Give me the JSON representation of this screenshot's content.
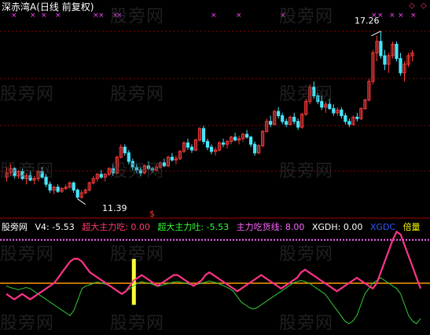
{
  "title": "深赤湾A(日线 前复权)",
  "price_high_label": "17.26",
  "price_low_label": "11.39",
  "watermark": "股旁网",
  "indicator_bar": {
    "source": "股旁网",
    "v4": {
      "label": "V4:",
      "value": "-5.53"
    },
    "items": [
      {
        "label": "超大主力吃:",
        "value": "0.00",
        "color": "#ff3b6b"
      },
      {
        "label": "超大主力吐:",
        "value": "-5.53",
        "color": "#33ff33"
      },
      {
        "label": "主力吃货线:",
        "value": "8.00",
        "color": "#ff66ff"
      },
      {
        "label": "XGDH:",
        "value": "0.00",
        "color": "#ffffff"
      },
      {
        "label": "XGDC",
        "value": "",
        "color": "#3355ff"
      },
      {
        "label": "倍量",
        "value": "",
        "color": "#ffff00"
      }
    ]
  },
  "colors": {
    "up": "#ff3b3b",
    "down": "#46e6ff",
    "grid": "#8a0000",
    "pink_line": "#ff3388",
    "green_line": "#33cc33",
    "orange_line": "#ff9900",
    "dotted_line": "#ff66ff",
    "yellow_bar": "#ffff33"
  },
  "icons": [
    "diamond-icon",
    "up-arrow-icon",
    "dollar-icon",
    "x-marker-icon"
  ],
  "price_axis_range": [
    10.8,
    17.8
  ],
  "candles": [
    [
      12.15,
      12.5,
      12.0,
      12.3
    ],
    [
      12.3,
      12.6,
      12.2,
      12.45
    ],
    [
      12.45,
      12.5,
      12.1,
      12.2
    ],
    [
      12.2,
      12.4,
      12.1,
      12.35
    ],
    [
      12.35,
      12.45,
      12.05,
      12.1
    ],
    [
      12.1,
      12.3,
      11.9,
      12.2
    ],
    [
      12.2,
      12.35,
      12.0,
      12.05
    ],
    [
      12.05,
      12.2,
      11.9,
      12.1
    ],
    [
      12.1,
      12.4,
      12.0,
      12.35
    ],
    [
      12.35,
      12.5,
      12.1,
      12.15
    ],
    [
      12.15,
      12.25,
      11.8,
      11.9
    ],
    [
      11.9,
      12.0,
      11.6,
      11.7
    ],
    [
      11.7,
      11.85,
      11.55,
      11.8
    ],
    [
      11.8,
      11.9,
      11.6,
      11.65
    ],
    [
      11.65,
      11.8,
      11.6,
      11.75
    ],
    [
      11.75,
      11.9,
      11.7,
      11.8
    ],
    [
      11.8,
      12.0,
      11.75,
      11.95
    ],
    [
      11.95,
      12.0,
      11.6,
      11.7
    ],
    [
      11.7,
      11.75,
      11.39,
      11.45
    ],
    [
      11.45,
      11.7,
      11.4,
      11.6
    ],
    [
      11.6,
      11.75,
      11.55,
      11.7
    ],
    [
      11.7,
      12.0,
      11.65,
      11.95
    ],
    [
      11.95,
      12.2,
      11.9,
      12.1
    ],
    [
      12.1,
      12.3,
      12.0,
      12.25
    ],
    [
      12.25,
      12.4,
      12.1,
      12.15
    ],
    [
      12.15,
      12.3,
      12.0,
      12.25
    ],
    [
      12.25,
      12.5,
      12.2,
      12.45
    ],
    [
      12.45,
      12.6,
      12.2,
      12.3
    ],
    [
      12.3,
      12.9,
      12.25,
      12.85
    ],
    [
      12.85,
      13.3,
      12.8,
      13.2
    ],
    [
      13.2,
      13.3,
      12.9,
      13.0
    ],
    [
      13.0,
      13.1,
      12.6,
      12.7
    ],
    [
      12.7,
      12.8,
      12.4,
      12.5
    ],
    [
      12.5,
      12.6,
      12.3,
      12.4
    ],
    [
      12.4,
      12.5,
      12.2,
      12.3
    ],
    [
      12.3,
      12.6,
      12.25,
      12.55
    ],
    [
      12.55,
      12.7,
      12.4,
      12.45
    ],
    [
      12.45,
      12.5,
      12.3,
      12.4
    ],
    [
      12.4,
      12.6,
      12.35,
      12.5
    ],
    [
      12.5,
      12.7,
      12.45,
      12.65
    ],
    [
      12.65,
      12.8,
      12.5,
      12.55
    ],
    [
      12.55,
      12.9,
      12.5,
      12.85
    ],
    [
      12.85,
      13.0,
      12.7,
      12.75
    ],
    [
      12.75,
      12.9,
      12.6,
      12.8
    ],
    [
      12.8,
      13.1,
      12.75,
      13.05
    ],
    [
      13.05,
      13.4,
      13.0,
      13.35
    ],
    [
      13.35,
      13.5,
      13.1,
      13.2
    ],
    [
      13.2,
      13.3,
      13.0,
      13.1
    ],
    [
      13.1,
      13.5,
      13.05,
      13.45
    ],
    [
      13.45,
      13.9,
      13.4,
      13.85
    ],
    [
      13.85,
      13.95,
      13.3,
      13.4
    ],
    [
      13.4,
      13.5,
      13.1,
      13.2
    ],
    [
      13.2,
      13.3,
      12.95,
      13.05
    ],
    [
      13.05,
      13.2,
      12.9,
      13.1
    ],
    [
      13.1,
      13.4,
      13.05,
      13.35
    ],
    [
      13.35,
      13.5,
      13.2,
      13.3
    ],
    [
      13.3,
      13.45,
      13.15,
      13.4
    ],
    [
      13.4,
      13.6,
      13.3,
      13.55
    ],
    [
      13.55,
      13.7,
      13.4,
      13.45
    ],
    [
      13.45,
      13.6,
      13.3,
      13.5
    ],
    [
      13.5,
      13.7,
      13.4,
      13.65
    ],
    [
      13.65,
      13.8,
      13.5,
      13.55
    ],
    [
      13.55,
      13.6,
      13.2,
      13.3
    ],
    [
      13.3,
      13.4,
      12.9,
      13.0
    ],
    [
      13.0,
      13.3,
      12.95,
      13.25
    ],
    [
      13.25,
      13.8,
      13.2,
      13.75
    ],
    [
      13.75,
      14.2,
      13.7,
      14.1
    ],
    [
      14.1,
      14.3,
      13.9,
      14.0
    ],
    [
      14.0,
      14.5,
      13.95,
      14.45
    ],
    [
      14.45,
      14.6,
      14.2,
      14.3
    ],
    [
      14.3,
      14.4,
      14.0,
      14.1
    ],
    [
      14.1,
      14.2,
      13.9,
      14.0
    ],
    [
      14.0,
      14.3,
      13.95,
      14.25
    ],
    [
      14.25,
      14.4,
      14.0,
      14.1
    ],
    [
      14.1,
      14.2,
      13.8,
      13.9
    ],
    [
      13.9,
      14.4,
      13.85,
      14.35
    ],
    [
      14.35,
      14.9,
      14.3,
      14.8
    ],
    [
      14.8,
      15.4,
      14.7,
      15.3
    ],
    [
      15.3,
      15.5,
      14.9,
      15.0
    ],
    [
      15.0,
      15.1,
      14.7,
      14.8
    ],
    [
      14.8,
      15.0,
      14.5,
      14.6
    ],
    [
      14.6,
      14.8,
      14.4,
      14.7
    ],
    [
      14.7,
      14.9,
      14.5,
      14.55
    ],
    [
      14.55,
      14.7,
      14.3,
      14.4
    ],
    [
      14.4,
      14.6,
      14.3,
      14.5
    ],
    [
      14.5,
      14.6,
      14.2,
      14.3
    ],
    [
      14.3,
      14.4,
      14.0,
      14.1
    ],
    [
      14.1,
      14.2,
      13.9,
      14.0
    ],
    [
      14.0,
      14.3,
      13.95,
      14.25
    ],
    [
      14.25,
      14.4,
      14.1,
      14.2
    ],
    [
      14.2,
      14.6,
      14.15,
      14.55
    ],
    [
      14.55,
      14.9,
      14.5,
      14.85
    ],
    [
      14.85,
      15.6,
      14.8,
      15.5
    ],
    [
      15.5,
      16.6,
      15.4,
      16.5
    ],
    [
      16.5,
      17.1,
      16.2,
      16.9
    ],
    [
      16.9,
      17.26,
      16.3,
      16.4
    ],
    [
      16.4,
      16.6,
      15.9,
      16.1
    ],
    [
      16.1,
      16.5,
      15.8,
      16.4
    ],
    [
      16.4,
      16.9,
      16.3,
      16.8
    ],
    [
      16.8,
      16.9,
      16.2,
      16.3
    ],
    [
      16.3,
      16.5,
      15.7,
      15.8
    ],
    [
      15.8,
      16.2,
      15.5,
      16.1
    ],
    [
      16.1,
      16.5,
      16.0,
      16.4
    ],
    [
      16.4,
      16.6,
      16.2,
      16.5
    ]
  ],
  "indicator_range": [
    -9,
    10
  ],
  "pink_series": [
    -2,
    -2.5,
    -3,
    -2.5,
    -2,
    -2.5,
    -3,
    -2.5,
    -2,
    -1.5,
    -1,
    -0.5,
    0,
    1,
    2,
    3,
    4,
    4.5,
    4.5,
    4,
    3,
    2,
    1.5,
    1,
    0.5,
    0,
    -0.5,
    -1,
    -1.5,
    -2,
    -1.5,
    -0.5,
    0.5,
    1,
    1.5,
    1,
    0.5,
    0,
    -0.5,
    0,
    0.5,
    1,
    1.5,
    1.5,
    1,
    0.5,
    0,
    -0.5,
    0,
    0.5,
    1.5,
    2,
    1.5,
    1,
    0.5,
    0,
    -0.5,
    -1,
    -1.5,
    -1,
    -0.5,
    0,
    0.5,
    1,
    1.5,
    1,
    0.5,
    0,
    -0.5,
    -1,
    -0.5,
    0,
    0.5,
    1,
    2,
    2.5,
    2,
    1.5,
    1,
    0.5,
    0,
    -0.5,
    -1,
    -1.5,
    -1,
    -0.5,
    0,
    0.5,
    1,
    0.5,
    0,
    -0.5,
    -1,
    0,
    2,
    4,
    6,
    8,
    9.5,
    9,
    7,
    5,
    3,
    1,
    -1
  ],
  "green_series": [
    -0.5,
    -0.8,
    -1,
    -1.2,
    -1,
    -0.8,
    -1,
    -1.5,
    -2,
    -2.5,
    -3,
    -3.5,
    -4,
    -4.5,
    -5,
    -5.5,
    -6,
    -5,
    -3,
    -1,
    -0.5,
    -0.3,
    0,
    0.2,
    0,
    -0.2,
    -0.5,
    -1,
    -1.5,
    -2,
    -1.5,
    -1,
    -0.5,
    0,
    0.3,
    0.1,
    0,
    -0.3,
    -0.6,
    -0.4,
    -0.2,
    0,
    0.2,
    0.3,
    0.1,
    0,
    -0.2,
    -0.4,
    -0.2,
    0,
    0.2,
    0.4,
    0.2,
    0,
    -0.3,
    -0.6,
    -1,
    -1.5,
    -2.5,
    -3.5,
    -4,
    -4.5,
    -4.8,
    -4.5,
    -4,
    -3.5,
    -3,
    -2.5,
    -2,
    -1.5,
    -1,
    -0.5,
    0,
    0.3,
    0.5,
    0.3,
    0,
    -0.5,
    -1,
    -1.5,
    -2,
    -3,
    -4,
    -5,
    -6,
    -7,
    -7.5,
    -7,
    -6,
    -4,
    -2,
    -1,
    0,
    0.5,
    1,
    0.5,
    0,
    -0.5,
    -1,
    -2,
    -4,
    -6,
    -7,
    -7.5,
    -6.5
  ],
  "yellow_bar_index": 29,
  "yellow_bar_value": 4.5
}
